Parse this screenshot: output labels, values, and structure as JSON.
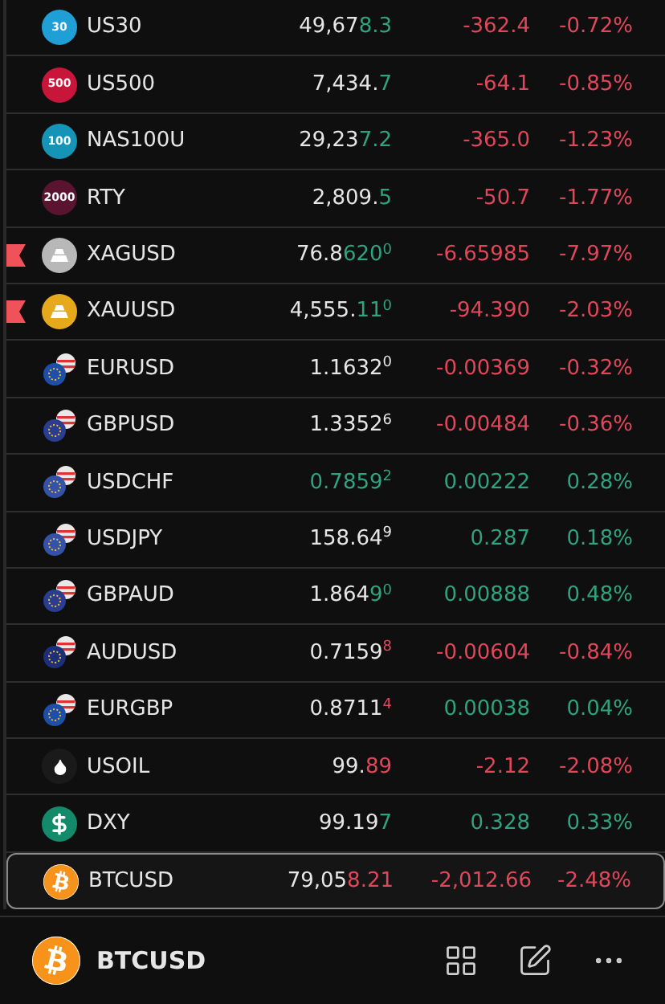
{
  "rows": [
    {
      "symbol": "US30",
      "icon": {
        "kind": "badge",
        "label": "30",
        "color": "#1f9fd6"
      },
      "flagged": false,
      "selected": false,
      "price": {
        "main": "49,67",
        "accent": "8.3",
        "rising": true
      },
      "change": "-362.4",
      "percent": "-0.72%",
      "rising": false
    },
    {
      "symbol": "US500",
      "icon": {
        "kind": "badge",
        "label": "500",
        "color": "#c8163a"
      },
      "flagged": false,
      "selected": false,
      "price": {
        "main": "7,434.",
        "accent": "7",
        "rising": true
      },
      "change": "-64.1",
      "percent": "-0.85%",
      "rising": false
    },
    {
      "symbol": "NAS100U",
      "icon": {
        "kind": "badge",
        "label": "100",
        "color": "#1594b8"
      },
      "flagged": false,
      "selected": false,
      "price": {
        "main": "29,23",
        "accent": "7.2",
        "rising": true
      },
      "change": "-365.0",
      "percent": "-1.23%",
      "rising": false
    },
    {
      "symbol": "RTY",
      "icon": {
        "kind": "badge",
        "label": "2000",
        "color": "#5a1430"
      },
      "flagged": false,
      "selected": false,
      "price": {
        "main": "2,809.",
        "accent": "5",
        "rising": true
      },
      "change": "-50.7",
      "percent": "-1.77%",
      "rising": false
    },
    {
      "symbol": "XAGUSD",
      "icon": {
        "kind": "metal",
        "color": "#b8b8b8"
      },
      "flagged": true,
      "selected": false,
      "price": {
        "main": "76.8",
        "accent": "620",
        "sup": "0",
        "rising": true
      },
      "change": "-6.65985",
      "percent": "-7.97%",
      "rising": false
    },
    {
      "symbol": "XAUUSD",
      "icon": {
        "kind": "metal",
        "color": "#e6a91c"
      },
      "flagged": true,
      "selected": false,
      "price": {
        "main": "4,555.",
        "accent": "11",
        "sup": "0",
        "rising": true
      },
      "change": "-94.390",
      "percent": "-2.03%",
      "rising": false
    },
    {
      "symbol": "EURUSD",
      "icon": {
        "kind": "pair",
        "color": "#1d4fa8"
      },
      "flagged": false,
      "selected": false,
      "price": {
        "main": "1.1632",
        "sup": "0"
      },
      "change": "-0.00369",
      "percent": "-0.32%",
      "rising": false
    },
    {
      "symbol": "GBPUSD",
      "icon": {
        "kind": "pair",
        "color": "#2a3d8f"
      },
      "flagged": false,
      "selected": false,
      "price": {
        "main": "1.3352",
        "sup": "6"
      },
      "change": "-0.00484",
      "percent": "-0.36%",
      "rising": false
    },
    {
      "symbol": "USDCHF",
      "icon": {
        "kind": "pair",
        "color": "#3452a8"
      },
      "flagged": false,
      "selected": false,
      "price": {
        "accent": "0.7859",
        "sup": "2",
        "rising": true
      },
      "change": "0.00222",
      "percent": "0.28%",
      "rising": true
    },
    {
      "symbol": "USDJPY",
      "icon": {
        "kind": "pair",
        "color": "#3452a8"
      },
      "flagged": false,
      "selected": false,
      "price": {
        "main": "158.64",
        "sup": "9"
      },
      "change": "0.287",
      "percent": "0.18%",
      "rising": true
    },
    {
      "symbol": "GBPAUD",
      "icon": {
        "kind": "pair",
        "color": "#2a3d8f"
      },
      "flagged": false,
      "selected": false,
      "price": {
        "main": "1.864",
        "accent": "9",
        "sup": "0",
        "rising": true
      },
      "change": "0.00888",
      "percent": "0.48%",
      "rising": true
    },
    {
      "symbol": "AUDUSD",
      "icon": {
        "kind": "pair",
        "color": "#1b2f7a"
      },
      "flagged": false,
      "selected": false,
      "price": {
        "main": "0.7159",
        "sup": "8",
        "rising": false
      },
      "change": "-0.00604",
      "percent": "-0.84%",
      "rising": false
    },
    {
      "symbol": "EURGBP",
      "icon": {
        "kind": "pair",
        "color": "#1d4fa8"
      },
      "flagged": false,
      "selected": false,
      "price": {
        "main": "0.8711",
        "sup": "4",
        "rising": false
      },
      "change": "0.00038",
      "percent": "0.04%",
      "rising": true
    },
    {
      "symbol": "USOIL",
      "icon": {
        "kind": "drop",
        "color": "#1a1a1a"
      },
      "flagged": false,
      "selected": false,
      "price": {
        "main": "99.",
        "accent": "89",
        "rising": false
      },
      "change": "-2.12",
      "percent": "-2.08%",
      "rising": false
    },
    {
      "symbol": "DXY",
      "icon": {
        "kind": "dollar",
        "color": "#138a6a"
      },
      "flagged": false,
      "selected": false,
      "price": {
        "main": "99.19",
        "accent": "7",
        "rising": true
      },
      "change": "0.328",
      "percent": "0.33%",
      "rising": true
    },
    {
      "symbol": "BTCUSD",
      "icon": {
        "kind": "bitcoin",
        "color": "#f7931a"
      },
      "flagged": false,
      "selected": true,
      "price": {
        "main": "79,05",
        "accent": "8.21",
        "rising": false
      },
      "change": "-2,012.66",
      "percent": "-2.48%",
      "rising": false
    }
  ],
  "footer": {
    "symbol": "BTCUSD",
    "icon": {
      "kind": "bitcoin",
      "color": "#f7931a"
    }
  }
}
